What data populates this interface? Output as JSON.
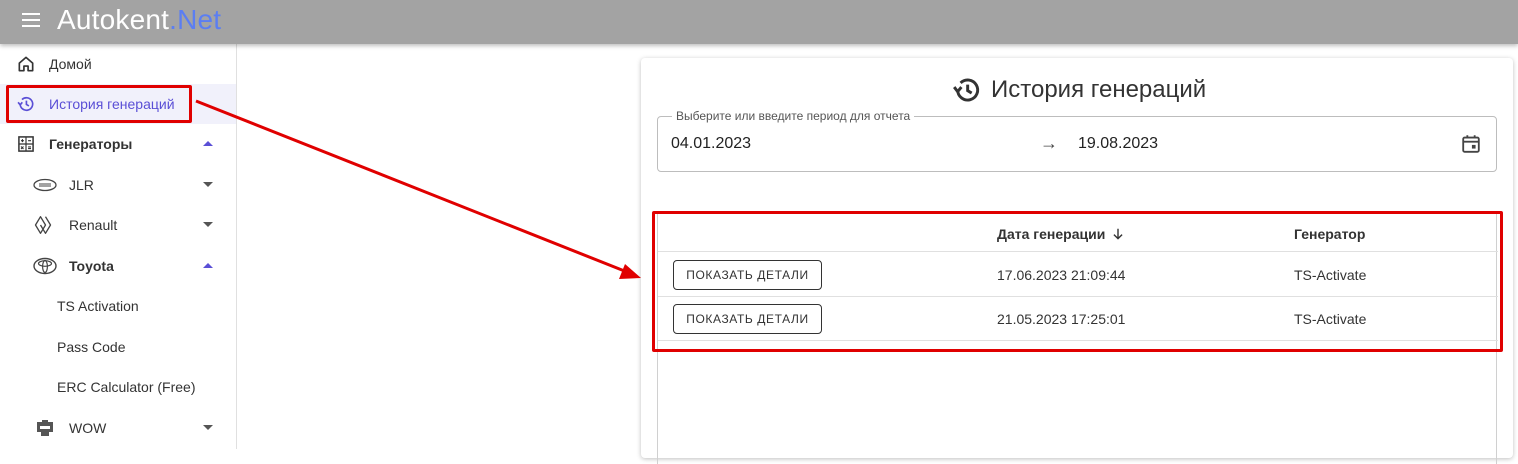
{
  "app": {
    "brand_main": "Autokent",
    "brand_accent": ".Net",
    "accent_color": "#5a4fd6",
    "header_color": "#a3a3a3"
  },
  "sidebar": {
    "items": [
      {
        "label": "Домой",
        "icon": "home-icon"
      },
      {
        "label": "История генераций",
        "icon": "history-icon",
        "active": true
      },
      {
        "label": "Генераторы",
        "icon": "calculator-icon",
        "expanded": true
      },
      {
        "label": "JLR",
        "icon": "land-rover-logo-icon",
        "expanded": false
      },
      {
        "label": "Renault",
        "icon": "renault-logo-icon",
        "expanded": false
      },
      {
        "label": "Toyota",
        "icon": "toyota-logo-icon",
        "expanded": true
      },
      {
        "label": "TS Activation"
      },
      {
        "label": "Pass Code"
      },
      {
        "label": "ERC Calculator (Free)"
      },
      {
        "label": "WOW",
        "icon": "wow-logo-icon",
        "expanded": false
      }
    ]
  },
  "main": {
    "title": "История генераций",
    "date_range": {
      "legend": "Выберите или введите период для отчета",
      "from": "04.01.2023",
      "arrow": "→",
      "to": "19.08.2023"
    },
    "table": {
      "columns": [
        "",
        "Дата генерации",
        "Генератор"
      ],
      "rows": [
        {
          "action": "ПОКАЗАТЬ ДЕТАЛИ",
          "date": "17.06.2023 21:09:44",
          "generator": "TS-Activate"
        },
        {
          "action": "ПОКАЗАТЬ ДЕТАЛИ",
          "date": "21.05.2023 17:25:01",
          "generator": "TS-Activate"
        }
      ]
    }
  },
  "annotation": {
    "highlight_color": "#e00000"
  }
}
